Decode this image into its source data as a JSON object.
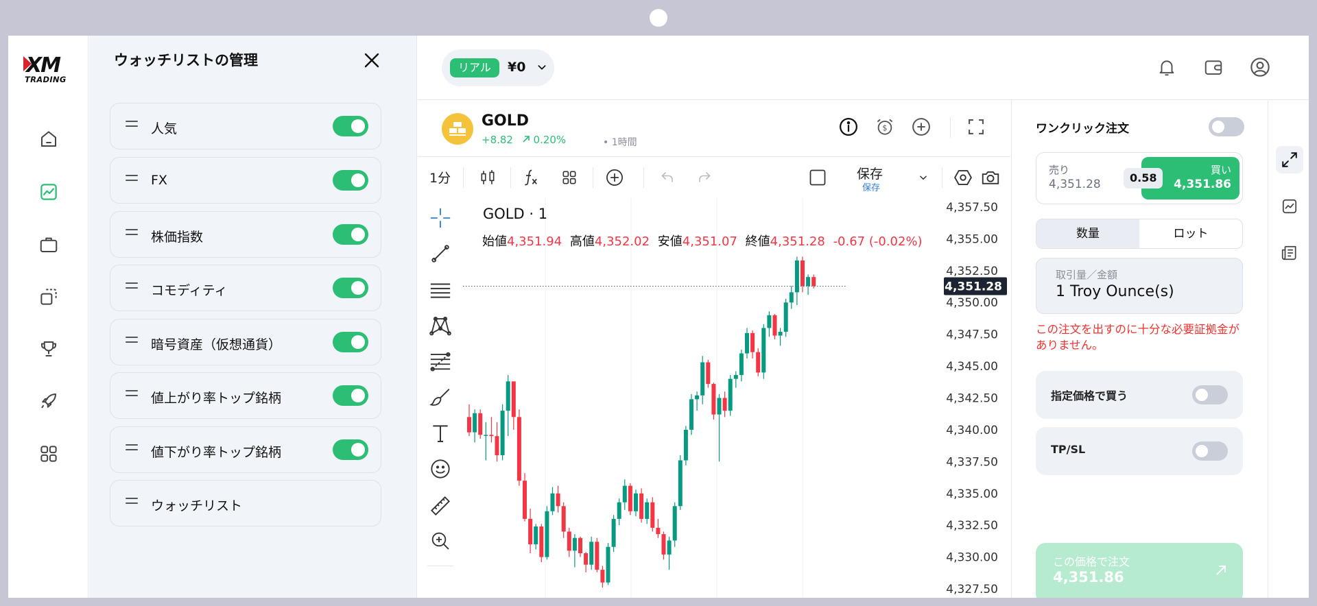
{
  "brand": {
    "logo_text": "XM",
    "logo_sub": "TRADING"
  },
  "nav": [
    {
      "icon": "home-icon"
    },
    {
      "icon": "chart-icon",
      "active": true
    },
    {
      "icon": "briefcase-icon"
    },
    {
      "icon": "copy-icon"
    },
    {
      "icon": "trophy-icon"
    },
    {
      "icon": "rocket-icon"
    },
    {
      "icon": "apps-icon"
    }
  ],
  "watchlist_panel": {
    "title": "ウォッチリストの管理",
    "items": [
      {
        "label": "人気",
        "enabled": true
      },
      {
        "label": "FX",
        "enabled": true
      },
      {
        "label": "株価指数",
        "enabled": true
      },
      {
        "label": "コモディティ",
        "enabled": true
      },
      {
        "label": "暗号資産（仮想通貨）",
        "enabled": true
      },
      {
        "label": "値上がり率トップ銘柄",
        "enabled": true
      },
      {
        "label": "値下がり率トップ銘柄",
        "enabled": true
      },
      {
        "label": "ウォッチリスト",
        "enabled": null
      }
    ]
  },
  "account": {
    "type": "リアル",
    "balance": "¥0"
  },
  "instrument": {
    "symbol": "GOLD",
    "change": "+8.82",
    "change_pct": "0.20%",
    "timeframe": "• 1時間"
  },
  "toolbar": {
    "interval": "1分",
    "save_label": "保存",
    "save_sub": "保存"
  },
  "chart": {
    "title": "GOLD · 1",
    "ohlc": {
      "open_label": "始値",
      "open": "4,351.94",
      "high_label": "高値",
      "high": "4,352.02",
      "low_label": "安値",
      "low": "4,351.07",
      "close_label": "終値",
      "close": "4,351.28",
      "change": "-0.67 (-0.02%)"
    },
    "last_price": "4,351.28",
    "colors": {
      "up": "#089981",
      "down": "#f23645"
    }
  },
  "chart_data": {
    "type": "candlestick",
    "y_ticks": [
      "4,357.50",
      "4,355.00",
      "4,352.50",
      "4,350.00",
      "4,347.50",
      "4,345.00",
      "4,342.50",
      "4,340.00",
      "4,337.50",
      "4,335.00",
      "4,332.50",
      "4,330.00",
      "4,327.50"
    ],
    "ylim": [
      4326.8,
      4358.2
    ],
    "last_price": 4351.28,
    "candles": [
      [
        4341.0,
        4342.0,
        4339.5,
        4339.8
      ],
      [
        4339.8,
        4341.6,
        4339.0,
        4341.3
      ],
      [
        4341.3,
        4341.6,
        4339.3,
        4339.6
      ],
      [
        4339.6,
        4340.6,
        4337.6,
        4339.6
      ],
      [
        4339.6,
        4341.0,
        4339.0,
        4339.5
      ],
      [
        4339.5,
        4340.6,
        4337.5,
        4338.0
      ],
      [
        4338.0,
        4342.0,
        4337.6,
        4341.5
      ],
      [
        4341.5,
        4344.3,
        4339.5,
        4343.8
      ],
      [
        4343.8,
        4343.8,
        4340.0,
        4341.0
      ],
      [
        4341.0,
        4341.6,
        4335.6,
        4336.0
      ],
      [
        4336.0,
        4336.6,
        4332.8,
        4333.0
      ],
      [
        4333.0,
        4333.8,
        4330.3,
        4331.0
      ],
      [
        4331.0,
        4332.6,
        4330.6,
        4332.4
      ],
      [
        4332.4,
        4332.6,
        4329.6,
        4330.0
      ],
      [
        4330.0,
        4334.0,
        4329.8,
        4333.6
      ],
      [
        4333.6,
        4335.5,
        4333.3,
        4335.0
      ],
      [
        4335.0,
        4335.6,
        4333.5,
        4334.0
      ],
      [
        4334.0,
        4334.3,
        4331.5,
        4332.0
      ],
      [
        4332.0,
        4332.3,
        4330.0,
        4330.5
      ],
      [
        4330.5,
        4331.8,
        4329.2,
        4331.5
      ],
      [
        4331.5,
        4331.6,
        4330.0,
        4330.3
      ],
      [
        4330.3,
        4330.4,
        4328.8,
        4329.4
      ],
      [
        4329.4,
        4331.6,
        4329.0,
        4331.2
      ],
      [
        4331.2,
        4331.5,
        4328.8,
        4329.0
      ],
      [
        4329.0,
        4329.3,
        4327.6,
        4328.0
      ],
      [
        4328.0,
        4331.1,
        4327.8,
        4330.8
      ],
      [
        4330.8,
        4333.3,
        4330.4,
        4333.0
      ],
      [
        4333.0,
        4334.6,
        4332.5,
        4334.3
      ],
      [
        4334.3,
        4336.1,
        4333.7,
        4335.6
      ],
      [
        4335.6,
        4335.8,
        4333.3,
        4333.6
      ],
      [
        4333.6,
        4335.3,
        4333.2,
        4335.0
      ],
      [
        4335.0,
        4335.4,
        4332.7,
        4333.0
      ],
      [
        4333.0,
        4334.6,
        4332.6,
        4334.3
      ],
      [
        4334.3,
        4334.7,
        4332.0,
        4332.3
      ],
      [
        4332.3,
        4333.0,
        4331.5,
        4331.8
      ],
      [
        4331.8,
        4332.0,
        4329.8,
        4330.2
      ],
      [
        4330.2,
        4331.6,
        4329.0,
        4331.3
      ],
      [
        4331.3,
        4334.3,
        4330.8,
        4334.0
      ],
      [
        4334.0,
        4338.0,
        4333.7,
        4337.6
      ],
      [
        4337.6,
        4340.3,
        4337.2,
        4340.0
      ],
      [
        4340.0,
        4342.8,
        4339.6,
        4342.4
      ],
      [
        4342.4,
        4343.0,
        4341.5,
        4342.7
      ],
      [
        4342.7,
        4345.8,
        4342.0,
        4345.3
      ],
      [
        4345.3,
        4345.5,
        4343.3,
        4343.6
      ],
      [
        4343.6,
        4343.7,
        4340.8,
        4341.2
      ],
      [
        4341.2,
        4342.8,
        4337.5,
        4342.5
      ],
      [
        4342.5,
        4343.0,
        4341.0,
        4341.5
      ],
      [
        4341.5,
        4344.3,
        4341.1,
        4344.0
      ],
      [
        4344.0,
        4344.6,
        4343.3,
        4344.3
      ],
      [
        4344.3,
        4346.3,
        4343.8,
        4346.0
      ],
      [
        4346.0,
        4348.0,
        4345.6,
        4347.6
      ],
      [
        4347.6,
        4347.8,
        4345.6,
        4346.1
      ],
      [
        4346.1,
        4346.4,
        4344.2,
        4344.5
      ],
      [
        4344.5,
        4348.3,
        4344.0,
        4348.0
      ],
      [
        4348.0,
        4349.3,
        4347.3,
        4349.0
      ],
      [
        4349.0,
        4349.1,
        4347.1,
        4347.4
      ],
      [
        4347.4,
        4348.0,
        4346.6,
        4347.7
      ],
      [
        4347.7,
        4350.3,
        4347.3,
        4350.0
      ],
      [
        4350.0,
        4351.3,
        4349.5,
        4350.8
      ],
      [
        4350.8,
        4353.6,
        4349.8,
        4353.3
      ],
      [
        4353.3,
        4353.6,
        4350.8,
        4351.3
      ],
      [
        4351.3,
        4352.2,
        4350.6,
        4352.0
      ],
      [
        4352.0,
        4352.2,
        4351.1,
        4351.3
      ]
    ]
  },
  "order_panel": {
    "one_click_label": "ワンクリック注文",
    "sell_label": "売り",
    "sell_price": "4,351.28",
    "buy_label": "買い",
    "buy_price": "4,351.86",
    "spread": "0.58",
    "tab_quantity": "数量",
    "tab_lot": "ロット",
    "amount_label": "取引量／金額",
    "amount_value": "1 Troy Ounce(s)",
    "warning": "この注文を出すのに十分な必要証拠金がありません。",
    "limit_label": "指定価格で買う",
    "tpsl_label": "TP/SL",
    "place_label": "この価格で注文",
    "place_price": "4,351.86"
  }
}
